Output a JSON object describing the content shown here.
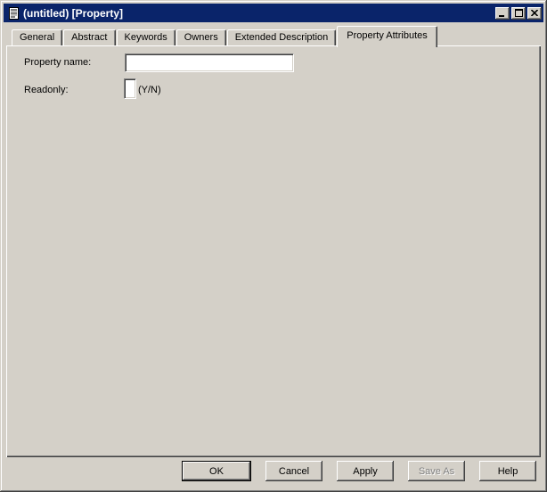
{
  "window": {
    "title": "(untitled) [Property]",
    "icon": "document-icon",
    "controls": {
      "minimize": "minimize",
      "maximize": "maximize",
      "close": "close"
    }
  },
  "tabs": [
    {
      "label": "General",
      "active": false
    },
    {
      "label": "Abstract",
      "active": false
    },
    {
      "label": "Keywords",
      "active": false
    },
    {
      "label": "Owners",
      "active": false
    },
    {
      "label": "Extended Description",
      "active": false
    },
    {
      "label": "Property Attributes",
      "active": true
    }
  ],
  "form": {
    "property_name": {
      "label": "Property name:",
      "value": ""
    },
    "readonly": {
      "label": "Readonly:",
      "value": "",
      "hint": "(Y/N)"
    }
  },
  "footer_buttons": {
    "ok": {
      "label": "OK",
      "default": true,
      "enabled": true
    },
    "cancel": {
      "label": "Cancel",
      "enabled": true
    },
    "apply": {
      "label": "Apply",
      "enabled": true
    },
    "save_as": {
      "label": "Save As",
      "enabled": false
    },
    "help": {
      "label": "Help",
      "enabled": true
    }
  },
  "colors": {
    "titlebar": "#0A246A",
    "face": "#D4D0C8",
    "title_text": "#FFFFFF"
  }
}
